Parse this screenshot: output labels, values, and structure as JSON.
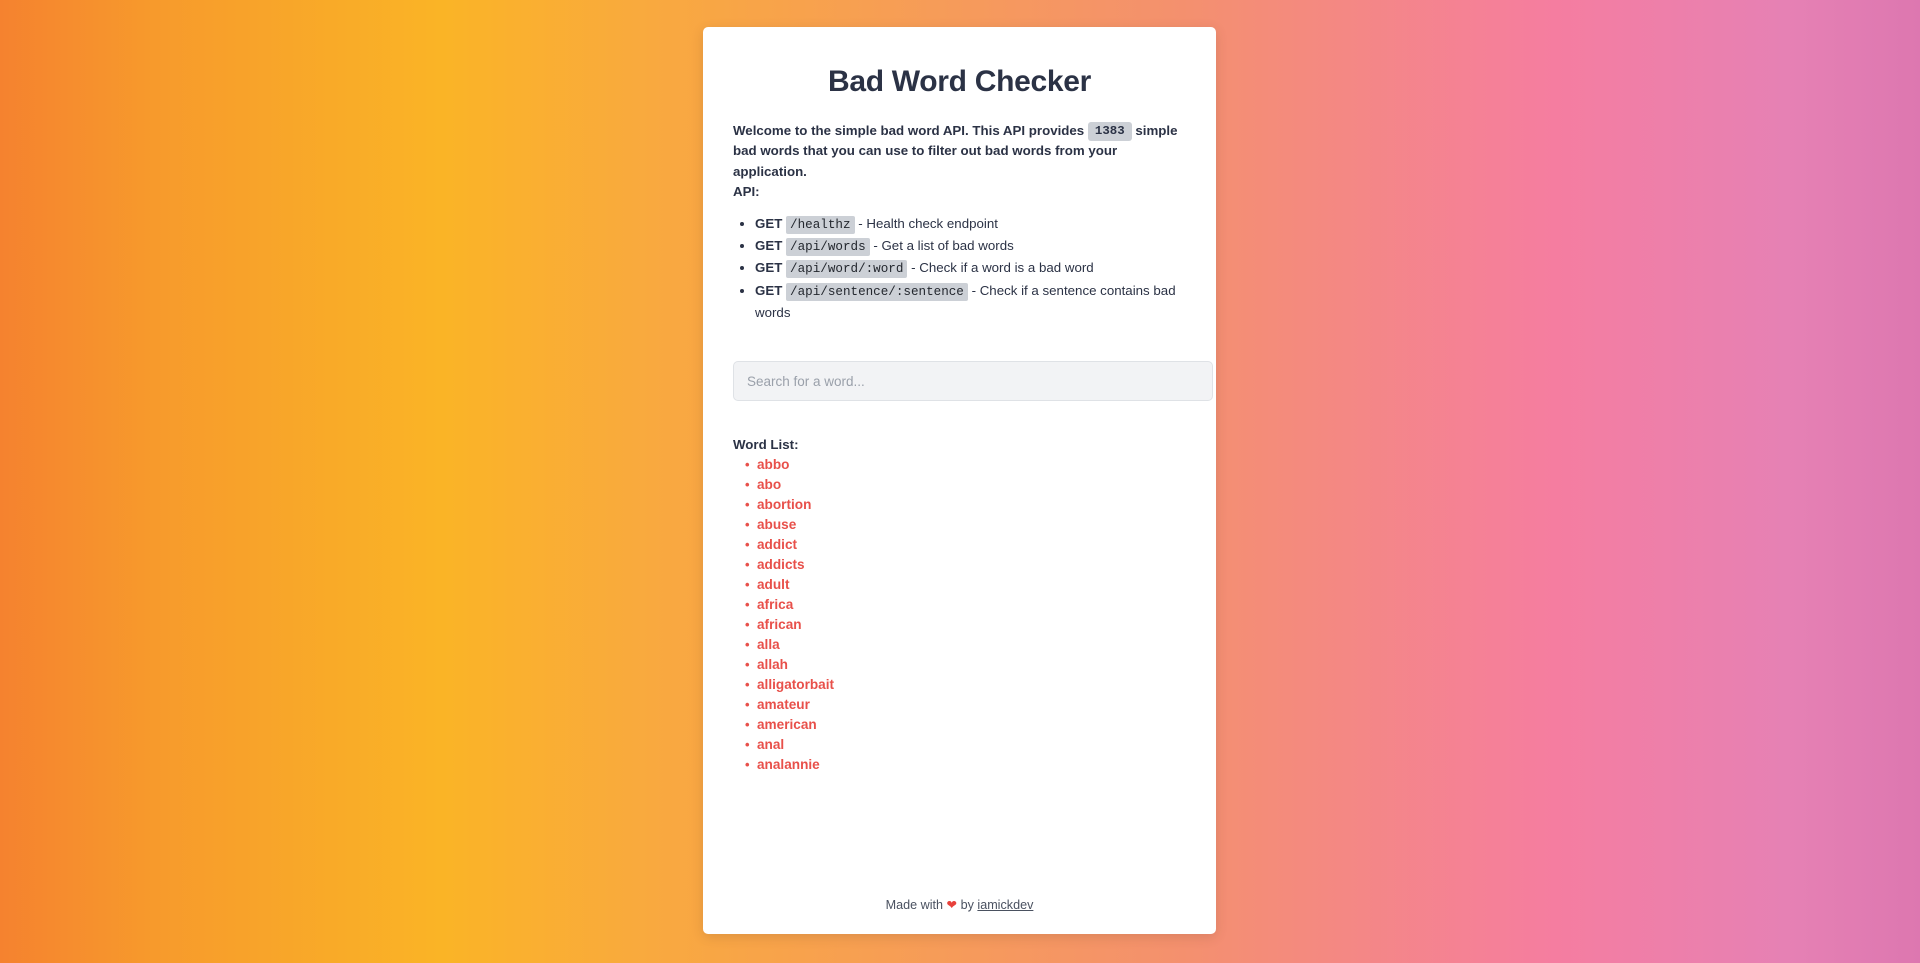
{
  "page": {
    "title": "Bad Word Checker"
  },
  "intro": {
    "text_before_badge": "Welcome to the simple bad word API. This API provides",
    "word_count": "1383",
    "text_after_badge": "simple bad words that you can use to filter out bad words from your application.",
    "api_label": "API:"
  },
  "endpoints": [
    {
      "method": "GET",
      "path": "/healthz",
      "description": "- Health check endpoint"
    },
    {
      "method": "GET",
      "path": "/api/words",
      "description": "- Get a list of bad words"
    },
    {
      "method": "GET",
      "path": "/api/word/:word",
      "description": "- Check if a word is a bad word"
    },
    {
      "method": "GET",
      "path": "/api/sentence/:sentence",
      "description": "- Check if a sentence contains bad words"
    }
  ],
  "search": {
    "value": "",
    "placeholder": "Search for a word..."
  },
  "word_list": {
    "label": "Word List:",
    "words": [
      "abbo",
      "abo",
      "abortion",
      "abuse",
      "addict",
      "addicts",
      "adult",
      "africa",
      "african",
      "alla",
      "allah",
      "alligatorbait",
      "amateur",
      "american",
      "anal",
      "analannie"
    ]
  },
  "footer": {
    "made_with": "Made with",
    "heart": "❤",
    "by": "by",
    "author": "iamickdev"
  },
  "colors": {
    "accent_red": "#e8504a",
    "title_navy": "#2b3245",
    "code_badge_bg": "#ccd0d6",
    "gradient_start": "#f5822f",
    "gradient_mid": "#fab426",
    "gradient_end": "#dd77b0"
  }
}
